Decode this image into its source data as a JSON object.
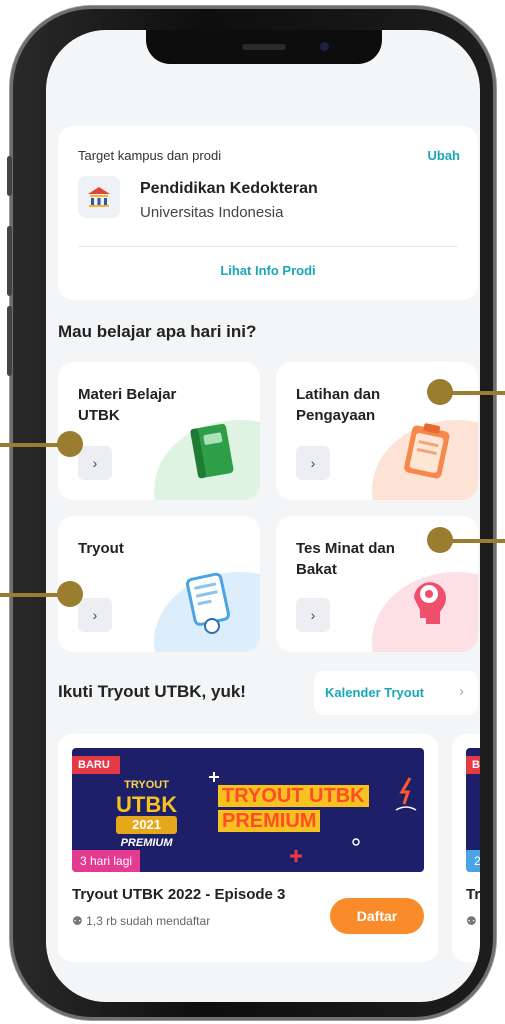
{
  "target": {
    "label": "Target kampus dan prodi",
    "change_label": "Ubah",
    "program": "Pendidikan Kedokteran",
    "university": "Universitas Indonesia",
    "info_link": "Lihat Info Prodi"
  },
  "study": {
    "heading": "Mau belajar apa hari ini?",
    "items": [
      {
        "title": "Materi Belajar UTBK",
        "arrow": "›",
        "icon": "book-icon",
        "color": "#3cb55a"
      },
      {
        "title": "Latihan dan Pengayaan",
        "arrow": "›",
        "icon": "clipboard-icon",
        "color": "#f5894f"
      },
      {
        "title": "Tryout",
        "arrow": "›",
        "icon": "document-icon",
        "color": "#4aa3e6"
      },
      {
        "title": "Tes Minat dan Bakat",
        "arrow": "›",
        "icon": "head-gear-icon",
        "color": "#ef4f6c"
      }
    ]
  },
  "tryout_section": {
    "heading": "Ikuti Tryout UTBK, yuk!",
    "calendar_label": "Kalender Tryout",
    "calendar_chevron": "›",
    "cards": [
      {
        "badge": "BARU",
        "banner_line1": "TRYOUT UTBK",
        "banner_line2": "PREMIUM",
        "logo_top": "TRYOUT",
        "logo_mid": "UTBK",
        "logo_year": "2021",
        "logo_bottom": "PREMIUM",
        "countdown": "3 hari lagi",
        "name": "Tryout UTBK 2022 - Episode 3",
        "registered": "1,3 rb sudah mendaftar",
        "register_label": "Daftar"
      },
      {
        "badge": "BA",
        "countdown": "2",
        "name": "Try",
        "registered": ""
      }
    ]
  },
  "colors": {
    "accent": "#1aa6b7",
    "orange": "#f98b2a",
    "callout": "#9a7d2e",
    "banner_bg": "#1d2068"
  }
}
